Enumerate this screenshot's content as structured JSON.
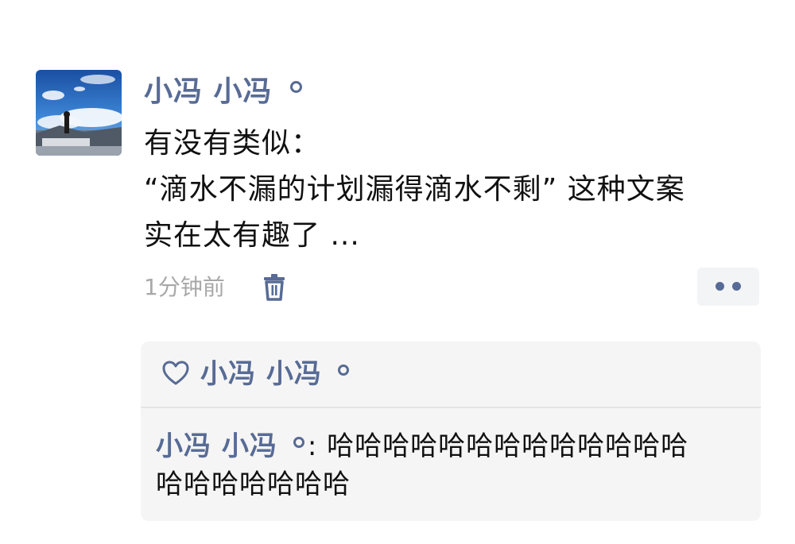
{
  "post": {
    "username": "小冯 小冯",
    "text_lines": [
      "有没有类似：",
      "“滴水不漏的计划漏得滴水不剩” 这种文案",
      "实在太有趣了 ..."
    ],
    "time": "1分钟前"
  },
  "icons": {
    "delete": "trash-icon",
    "more": "more-dots-icon",
    "like": "heart-icon"
  },
  "likes": {
    "names": "小冯 小冯"
  },
  "comments": [
    {
      "author": "小冯 小冯",
      "separator": ":",
      "text_line1": "哈哈哈哈哈哈哈哈哈哈哈哈哈",
      "text_line2": "哈哈哈哈哈哈哈"
    }
  ],
  "colors": {
    "link_blue": "#576b95",
    "time_gray": "#a8a8a8",
    "comment_bg": "#f5f5f5"
  }
}
